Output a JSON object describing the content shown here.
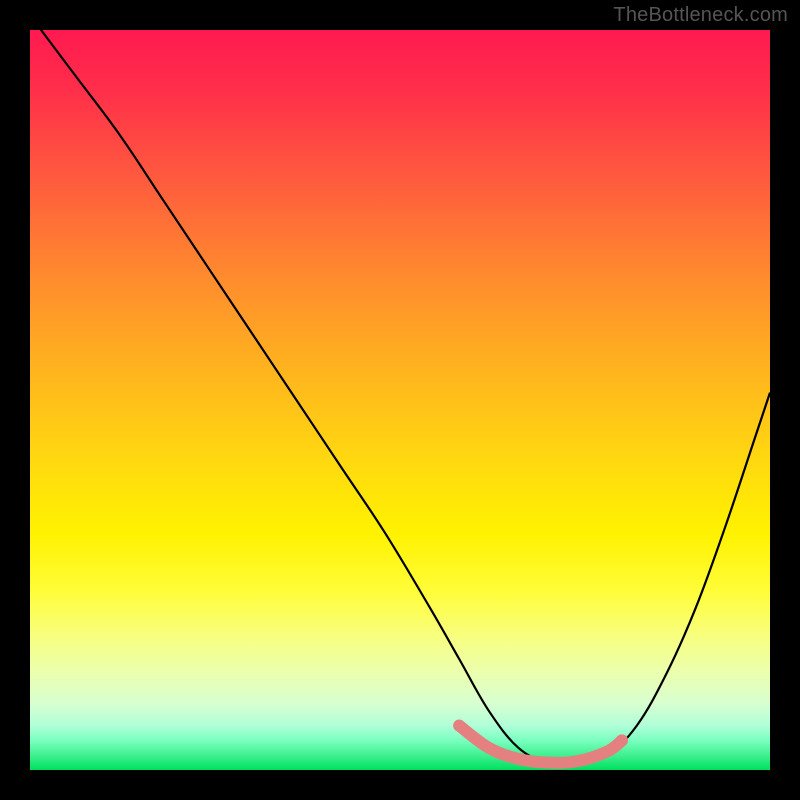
{
  "watermark": "TheBottleneck.com",
  "chart_data": {
    "type": "line",
    "title": "",
    "xlabel": "",
    "ylabel": "",
    "xlim": [
      0,
      100
    ],
    "ylim": [
      0,
      100
    ],
    "grid": false,
    "legend": false,
    "annotations": [],
    "series": [
      {
        "name": "curve",
        "color": "#000000",
        "x": [
          0,
          6,
          12,
          18,
          24,
          30,
          36,
          42,
          48,
          54,
          58,
          62,
          66,
          70,
          74,
          78,
          82,
          86,
          90,
          94,
          98,
          100
        ],
        "values": [
          102,
          94,
          86,
          77,
          68,
          59,
          50,
          41,
          32,
          22,
          15,
          8,
          3,
          1,
          1,
          2,
          6,
          13,
          22,
          33,
          45,
          51
        ]
      },
      {
        "name": "marker-band",
        "color": "#e58080",
        "x": [
          58,
          62,
          66,
          70,
          74,
          78,
          80
        ],
        "values": [
          6,
          3,
          1.5,
          1,
          1.2,
          2.5,
          4
        ]
      }
    ],
    "gradient_stops": [
      {
        "pos": 0,
        "color": "#ff1a50"
      },
      {
        "pos": 8,
        "color": "#ff2e4a"
      },
      {
        "pos": 20,
        "color": "#ff5a3e"
      },
      {
        "pos": 33,
        "color": "#ff8a2e"
      },
      {
        "pos": 46,
        "color": "#ffb41e"
      },
      {
        "pos": 58,
        "color": "#ffd810"
      },
      {
        "pos": 68,
        "color": "#fff200"
      },
      {
        "pos": 76,
        "color": "#fffd3a"
      },
      {
        "pos": 82,
        "color": "#f8ff80"
      },
      {
        "pos": 87,
        "color": "#eaffb0"
      },
      {
        "pos": 91,
        "color": "#d8ffd0"
      },
      {
        "pos": 94,
        "color": "#b0ffd8"
      },
      {
        "pos": 96,
        "color": "#7affc0"
      },
      {
        "pos": 98,
        "color": "#40f090"
      },
      {
        "pos": 100,
        "color": "#00e060"
      }
    ]
  }
}
